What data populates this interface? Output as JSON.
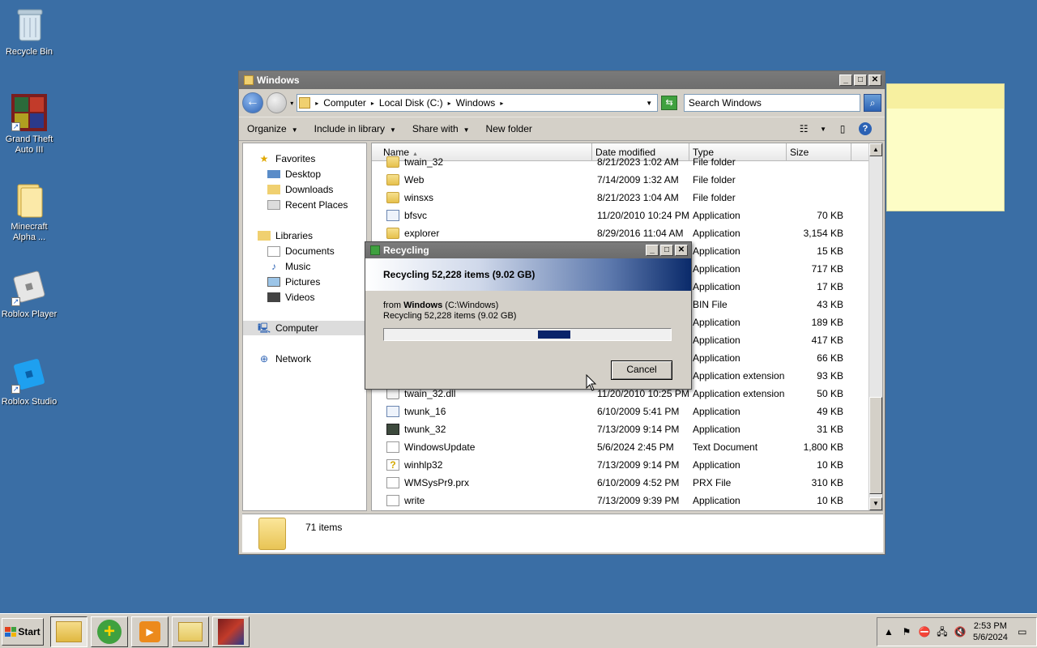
{
  "desktop": {
    "icons": [
      {
        "label": "Recycle Bin"
      },
      {
        "label": "Grand Theft Auto III"
      },
      {
        "label": "Minecraft Alpha ..."
      },
      {
        "label": "Roblox Player"
      },
      {
        "label": "Roblox Studio"
      }
    ]
  },
  "explorer": {
    "title": "Windows",
    "breadcrumbs": [
      "Computer",
      "Local Disk (C:)",
      "Windows"
    ],
    "search_placeholder": "Search Windows",
    "commands": {
      "organize": "Organize",
      "include": "Include in library",
      "share": "Share with",
      "new_folder": "New folder"
    },
    "nav": {
      "favorites": "Favorites",
      "desktop": "Desktop",
      "downloads": "Downloads",
      "recent": "Recent Places",
      "libraries": "Libraries",
      "documents": "Documents",
      "music": "Music",
      "pictures": "Pictures",
      "videos": "Videos",
      "computer": "Computer",
      "network": "Network"
    },
    "columns": {
      "name": "Name",
      "date": "Date modified",
      "type": "Type",
      "size": "Size"
    },
    "files": [
      {
        "name": "twain_32",
        "date": "8/21/2023 1:02 AM",
        "type": "File folder",
        "size": "",
        "icon": "folder"
      },
      {
        "name": "Web",
        "date": "7/14/2009 1:32 AM",
        "type": "File folder",
        "size": "",
        "icon": "folder"
      },
      {
        "name": "winsxs",
        "date": "8/21/2023 1:04 AM",
        "type": "File folder",
        "size": "",
        "icon": "folder"
      },
      {
        "name": "bfsvc",
        "date": "11/20/2010 10:24 PM",
        "type": "Application",
        "size": "70 KB",
        "icon": "app"
      },
      {
        "name": "explorer",
        "date": "8/29/2016 11:04 AM",
        "type": "Application",
        "size": "3,154 KB",
        "icon": "folder"
      },
      {
        "name": "",
        "date": "",
        "type": "Application",
        "size": "15 KB",
        "icon": "app"
      },
      {
        "name": "",
        "date": "",
        "type": "Application",
        "size": "717 KB",
        "icon": "app"
      },
      {
        "name": "",
        "date": "",
        "type": "Application",
        "size": "17 KB",
        "icon": "app"
      },
      {
        "name": "",
        "date": "",
        "type": "BIN File",
        "size": "43 KB",
        "icon": "doc"
      },
      {
        "name": "",
        "date": "",
        "type": "Application",
        "size": "189 KB",
        "icon": "app"
      },
      {
        "name": "",
        "date": "",
        "type": "Application",
        "size": "417 KB",
        "icon": "app"
      },
      {
        "name": "",
        "date": "",
        "type": "Application",
        "size": "66 KB",
        "icon": "app"
      },
      {
        "name": "",
        "date": "",
        "type": "Application extension",
        "size": "93 KB",
        "icon": "ext"
      },
      {
        "name": "twain_32.dll",
        "date": "11/20/2010 10:25 PM",
        "type": "Application extension",
        "size": "50 KB",
        "icon": "ext"
      },
      {
        "name": "twunk_16",
        "date": "6/10/2009 5:41 PM",
        "type": "Application",
        "size": "49 KB",
        "icon": "app"
      },
      {
        "name": "twunk_32",
        "date": "7/13/2009 9:14 PM",
        "type": "Application",
        "size": "31 KB",
        "icon": "dark"
      },
      {
        "name": "WindowsUpdate",
        "date": "5/6/2024 2:45 PM",
        "type": "Text Document",
        "size": "1,800 KB",
        "icon": "doc"
      },
      {
        "name": "winhlp32",
        "date": "7/13/2009 9:14 PM",
        "type": "Application",
        "size": "10 KB",
        "icon": "help"
      },
      {
        "name": "WMSysPr9.prx",
        "date": "6/10/2009 4:52 PM",
        "type": "PRX File",
        "size": "310 KB",
        "icon": "doc"
      },
      {
        "name": "write",
        "date": "7/13/2009 9:39 PM",
        "type": "Application",
        "size": "10 KB",
        "icon": "doc"
      }
    ],
    "item_count": "71 items"
  },
  "dialog": {
    "title": "Recycling",
    "heading": "Recycling 52,228 items (9.02 GB)",
    "from_prefix": "from ",
    "from_name": "Windows",
    "from_path": " (C:\\Windows)",
    "detail": "Recycling 52,228 items (9.02 GB)",
    "cancel": "Cancel"
  },
  "taskbar": {
    "start": "Start",
    "time": "2:53 PM",
    "date": "5/6/2024"
  }
}
